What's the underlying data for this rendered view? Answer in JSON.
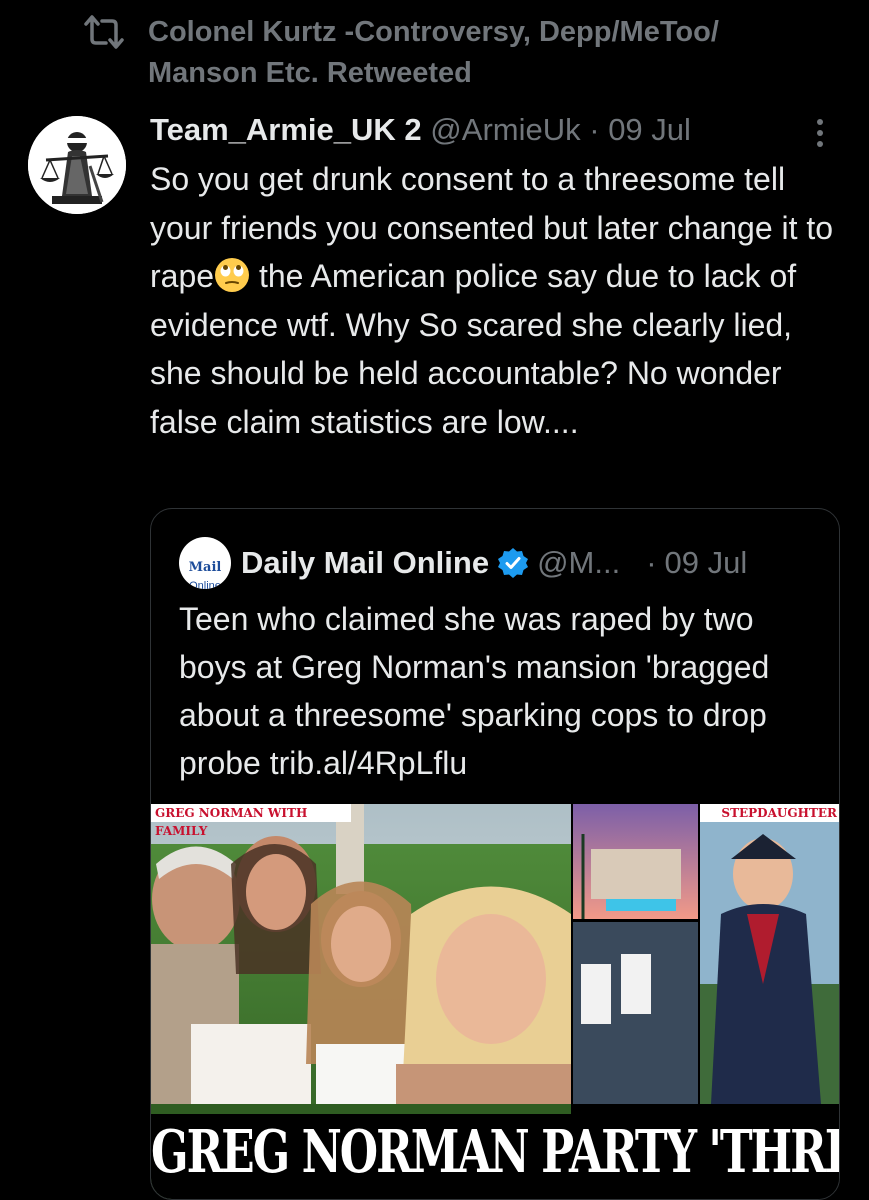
{
  "retweet": {
    "icon": "retweet-icon",
    "text": "Colonel Kurtz -Controversy, Depp/MeToo/ Manson Etc. Retweeted"
  },
  "tweet": {
    "avatar_icon": "lady-justice-avatar",
    "author_name": "Team_Armie_UK 2",
    "handle": "@ArmieUk",
    "separator": "·",
    "date": "09 Jul",
    "more_icon": "more-vertical-icon",
    "text_before_emoji": "So you get drunk consent to a threesome tell your friends you consented but later change it to rape",
    "emoji": "face-with-rolling-eyes",
    "text_after_emoji": " the American police say due to lack of evidence wtf. Why So scared she clearly lied, she should be held accountable? No wonder false claim statistics are low...."
  },
  "quote": {
    "logo_top": "Mail",
    "logo_bottom": "Online",
    "author_name": "Daily Mail Online",
    "verified_icon": "verified-badge-icon",
    "handle": "@M...",
    "separator": "·",
    "date": "09 Jul",
    "text": "Teen who claimed she was raped by two boys at Greg Norman's mansion 'bragged about a threesome' sparking cops to drop probe trib.al/4RpLflu",
    "image": {
      "left_caption": "GREG NORMAN WITH FAMILY",
      "right_caption": "STEPDAUGHTER",
      "headline": "GREG NORMAN PARTY 'THREESOME'"
    }
  },
  "colors": {
    "background": "#000000",
    "text_primary": "#e7e9ea",
    "text_secondary": "#71767b",
    "border": "#2f3336",
    "verified": "#1d9bf0",
    "caption_red": "#c8102e"
  }
}
